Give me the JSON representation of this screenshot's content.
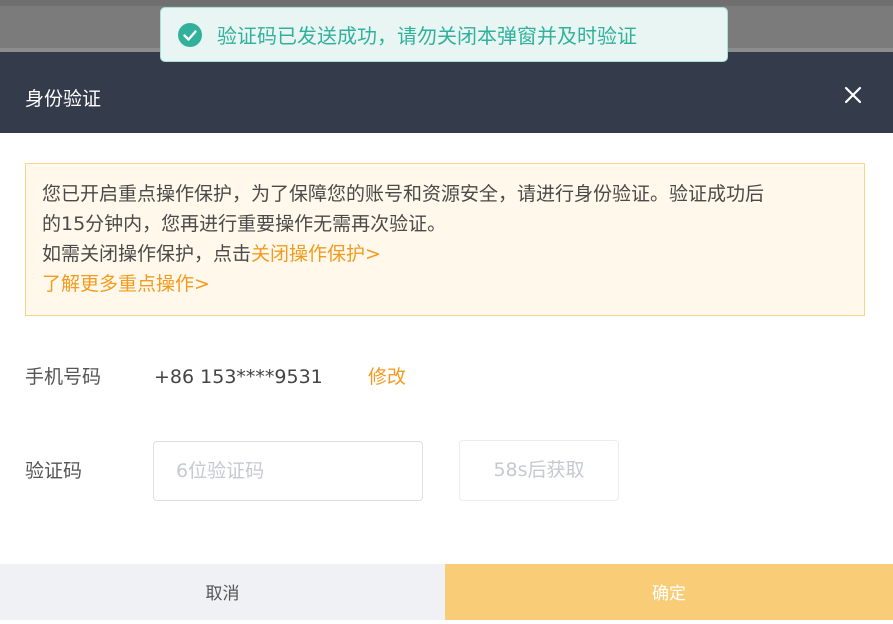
{
  "toast": {
    "icon": "check-circle-icon",
    "message": "验证码已发送成功，请勿关闭本弹窗并及时验证",
    "color": "#31b19b"
  },
  "modal": {
    "title": "身份验证",
    "close_icon": "close-icon"
  },
  "notice": {
    "line1": "您已开启重点操作保护，为了保障您的账号和资源安全，请进行身份验证。验证成功后",
    "line2": "的15分钟内，您再进行重要操作无需再次验证。",
    "line3_prefix": "如需关闭操作保护，点击",
    "close_protection_link": "关闭操作保护>",
    "learn_more_link": "了解更多重点操作>",
    "link_color": "#f39b1f"
  },
  "phone": {
    "label": "手机号码",
    "value": "+86 153****9531",
    "modify_label": "修改"
  },
  "code": {
    "label": "验证码",
    "value": "",
    "placeholder": "6位验证码",
    "resend_label": "58s后获取"
  },
  "footer": {
    "cancel_label": "取消",
    "confirm_label": "确定",
    "confirm_color": "#f9cd77"
  }
}
